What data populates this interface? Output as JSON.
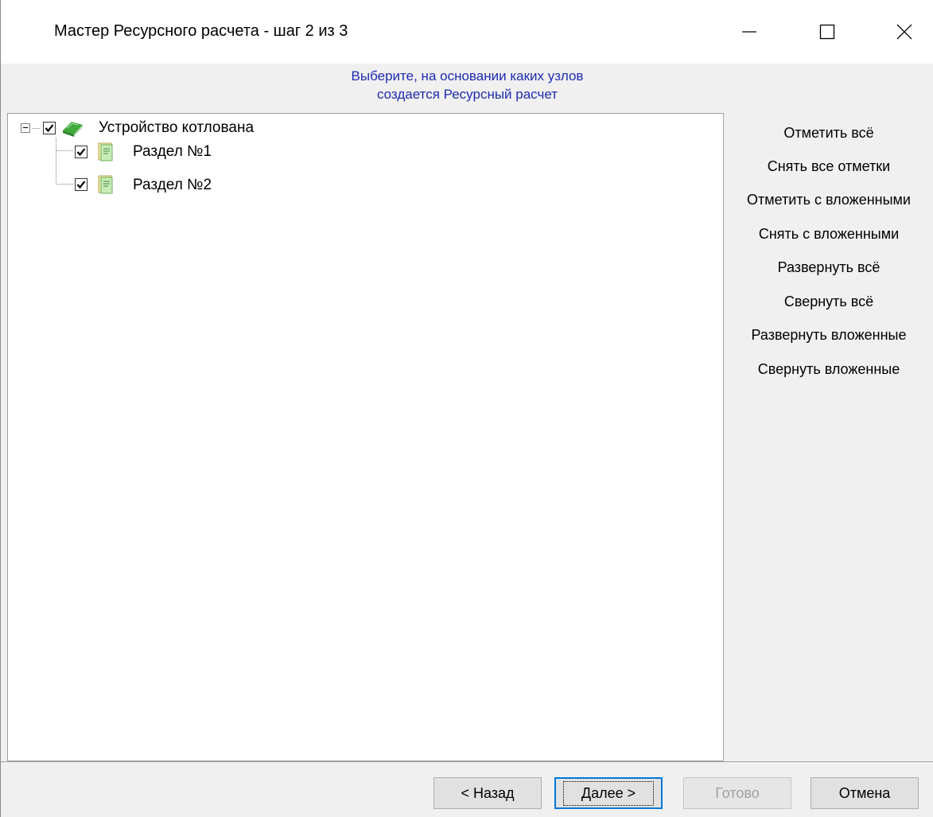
{
  "window": {
    "title": "Мастер Ресурсного расчета - шаг 2 из 3"
  },
  "header": {
    "line1": "Выберите, на основании каких узлов",
    "line2": "создается Ресурсный расчет",
    "color": "#1e2bb0"
  },
  "tree": {
    "root": {
      "label": "Устройство котлована",
      "checked": true,
      "expanded": true,
      "icon": "book-icon",
      "children": [
        {
          "label": "Раздел №1",
          "checked": true,
          "icon": "document-icon"
        },
        {
          "label": "Раздел №2",
          "checked": true,
          "icon": "document-icon"
        }
      ]
    }
  },
  "actions": [
    "Отметить всё",
    "Снять все отметки",
    "Отметить с вложенными",
    "Снять с вложенными",
    "Развернуть всё",
    "Свернуть всё",
    "Развернуть вложенные",
    "Свернуть вложенные"
  ],
  "buttons": {
    "back": "< Назад",
    "next": "Далее >",
    "finish": "Готово",
    "cancel": "Отмена"
  }
}
